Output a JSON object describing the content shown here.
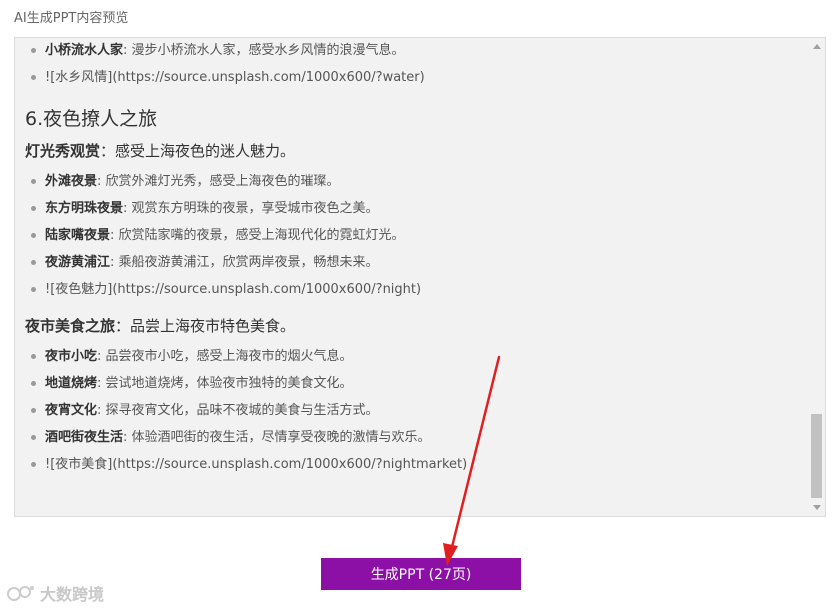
{
  "header": {
    "title": "AI生成PPT内容预览"
  },
  "preview": {
    "blocks": [
      {
        "items": [
          {
            "term": "小桥流水人家",
            "text": ": 漫步小桥流水人家，感受水乡风情的浪漫气息。"
          },
          {
            "term": "",
            "text": "![水乡风情](https://source.unsplash.com/1000x600/?water)"
          }
        ]
      }
    ],
    "chapter": {
      "title": "6.夜色撩人之旅",
      "sections": [
        {
          "term": "灯光秀观赏",
          "text": "：感受上海夜色的迷人魅力。",
          "items": [
            {
              "term": "外滩夜景",
              "text": ": 欣赏外滩灯光秀，感受上海夜色的璀璨。"
            },
            {
              "term": "东方明珠夜景",
              "text": ": 观赏东方明珠的夜景，享受城市夜色之美。"
            },
            {
              "term": "陆家嘴夜景",
              "text": ": 欣赏陆家嘴的夜景，感受上海现代化的霓虹灯光。"
            },
            {
              "term": "夜游黄浦江",
              "text": ": 乘船夜游黄浦江，欣赏两岸夜景，畅想未来。"
            },
            {
              "term": "",
              "text": "![夜色魅力](https://source.unsplash.com/1000x600/?night)"
            }
          ]
        },
        {
          "term": "夜市美食之旅",
          "text": "：品尝上海夜市特色美食。",
          "items": [
            {
              "term": "夜市小吃",
              "text": ": 品尝夜市小吃，感受上海夜市的烟火气息。"
            },
            {
              "term": "地道烧烤",
              "text": ": 尝试地道烧烤，体验夜市独特的美食文化。"
            },
            {
              "term": "夜宵文化",
              "text": ": 探寻夜宵文化，品味不夜城的美食与生活方式。"
            },
            {
              "term": "酒吧街夜生活",
              "text": ": 体验酒吧街的夜生活，尽情享受夜晚的激情与欢乐。"
            },
            {
              "term": "",
              "text": "![夜市美食](https://source.unsplash.com/1000x600/?nightmarket)"
            }
          ]
        }
      ]
    }
  },
  "actions": {
    "generate_label": "生成PPT (27页)"
  },
  "watermark": {
    "text": "大数跨境"
  },
  "colors": {
    "button": "#8c10a6",
    "arrow": "#e02020",
    "panel": "#f2f2f2"
  }
}
